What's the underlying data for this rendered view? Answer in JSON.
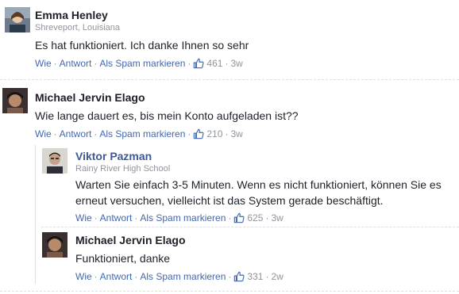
{
  "comments": [
    {
      "name": "Emma Henley",
      "subtitle": "Shreveport, Louisiana",
      "text": "Es hat funktioniert. Ich danke Ihnen so sehr",
      "actions": {
        "like": "Wie",
        "reply": "Antwort",
        "spam": "Als Spam markieren",
        "likes": "461",
        "time": "3w"
      }
    },
    {
      "name": "Michael Jervin Elago",
      "text": "Wie lange dauert es, bis mein Konto aufgeladen ist??",
      "actions": {
        "like": "Wie",
        "reply": "Antwort",
        "spam": "Als Spam markieren",
        "likes": "210",
        "time": "3w"
      },
      "replies": [
        {
          "name": "Viktor Pazman",
          "subtitle": "Rainy River High School",
          "text": "Warten Sie einfach 3-5 Minuten. Wenn es nicht funktioniert, können Sie es erneut versuchen, vielleicht ist das System gerade beschäftigt.",
          "actions": {
            "like": "Wie",
            "reply": "Antwort",
            "spam": "Als Spam markieren",
            "likes": "625",
            "time": "3w"
          }
        },
        {
          "name": "Michael Jervin Elago",
          "text": "Funktioniert, danke",
          "actions": {
            "like": "Wie",
            "reply": "Antwort",
            "spam": "Als Spam markieren",
            "likes": "331",
            "time": "2w"
          }
        }
      ]
    }
  ],
  "colors": {
    "link": "#4267b2",
    "name_link": "#3b5998",
    "meta": "#90949c"
  }
}
